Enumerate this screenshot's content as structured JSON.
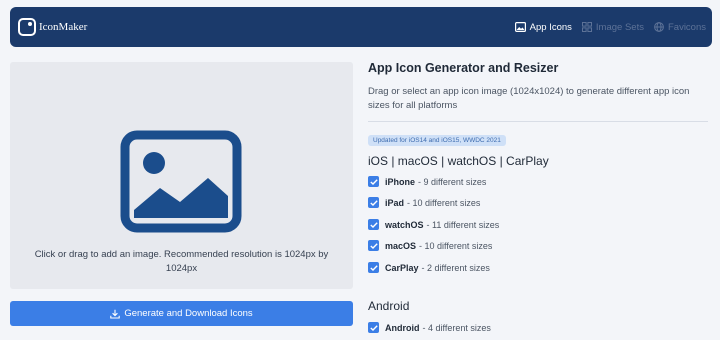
{
  "navbar": {
    "brand": "IconMaker",
    "links": [
      {
        "label": "App Icons",
        "icon": "image-icon",
        "active": true
      },
      {
        "label": "Image Sets",
        "icon": "grid-icon",
        "active": false
      },
      {
        "label": "Favicons",
        "icon": "globe-icon",
        "active": false
      }
    ]
  },
  "dropzone": {
    "icon": "image-placeholder-icon",
    "text": "Click or drag to add an image. Recommended resolution is 1024px by 1024px"
  },
  "generate_button": {
    "label": "Generate and Download Icons",
    "icon": "download-icon"
  },
  "panel": {
    "title": "App Icon Generator and Resizer",
    "description": "Drag or select an app icon image (1024x1024) to generate different app icon sizes for all platforms",
    "badge": "Updated for iOS14 and iOS15, WWDC 2021",
    "apple": {
      "heading": "iOS | macOS | watchOS | CarPlay",
      "items": [
        {
          "name": "iPhone",
          "sizes": "- 9 different sizes",
          "checked": true
        },
        {
          "name": "iPad",
          "sizes": "- 10 different sizes",
          "checked": true
        },
        {
          "name": "watchOS",
          "sizes": "- 11 different sizes",
          "checked": true
        },
        {
          "name": "macOS",
          "sizes": "- 10 different sizes",
          "checked": true
        },
        {
          "name": "CarPlay",
          "sizes": "- 2 different sizes",
          "checked": true
        }
      ]
    },
    "android": {
      "heading": "Android",
      "items": [
        {
          "name": "Android",
          "sizes": "- 4 different sizes",
          "checked": true
        }
      ]
    }
  },
  "colors": {
    "navbar": "#1b3a6b",
    "accent": "#3b7ee6",
    "badge_bg": "#cfe0f7"
  }
}
